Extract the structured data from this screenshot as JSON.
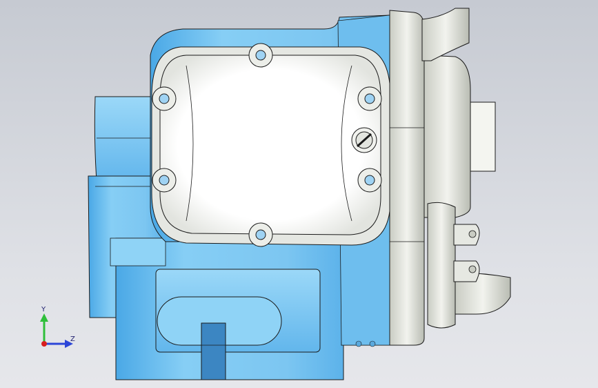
{
  "viewport": {
    "background_top": "#c6cad2",
    "background_bottom": "#e6e7eb"
  },
  "model": {
    "body_color": "#7ec8f2",
    "cover_color": "#ffffff",
    "flange_color": "#e9ebe4",
    "edge_color": "#1a1a1a",
    "bolt_hole_color": "#9fd3f3"
  },
  "triad": {
    "y_label": "Y",
    "z_label": "Z",
    "y_color": "#2fbf3a",
    "z_color": "#2c46d8",
    "x_color": "#d81e1e"
  }
}
